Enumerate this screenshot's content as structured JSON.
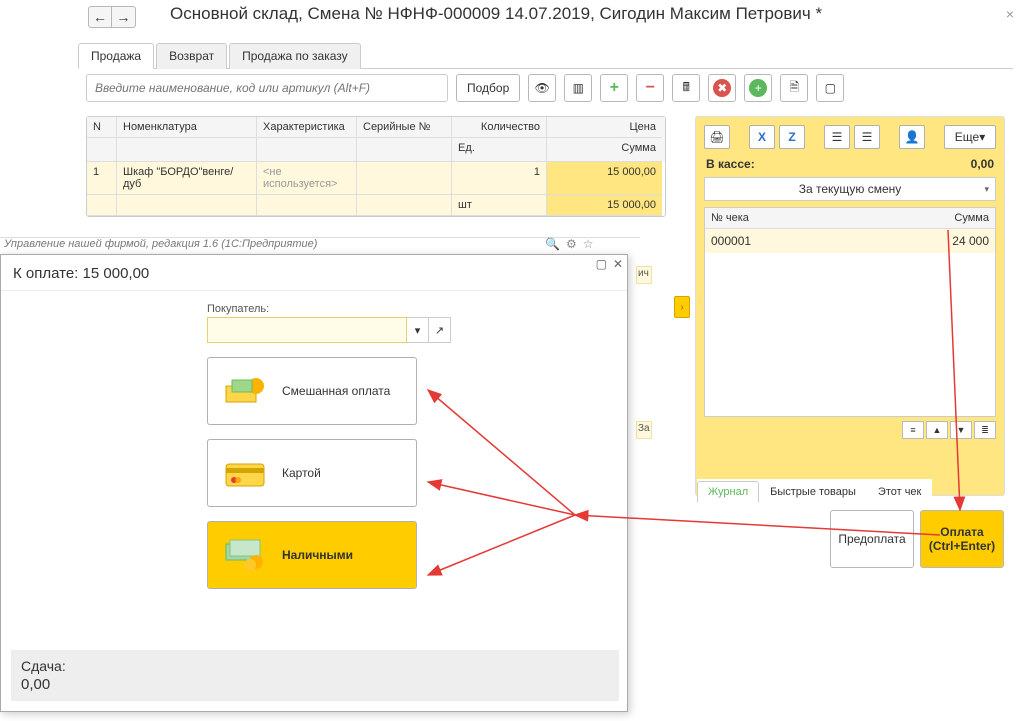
{
  "header": {
    "back": "←",
    "fwd": "→",
    "title": "Основной склад, Смена № НФНФ-000009  14.07.2019, Сигодин Максим Петрович *"
  },
  "tabs": {
    "t1": "Продажа",
    "t2": "Возврат",
    "t3": "Продажа по заказу"
  },
  "search": {
    "ph": "Введите наименование, код или артикул (Alt+F)"
  },
  "toolbar": {
    "pick": "Подбор",
    "eye": "👁",
    "bar": "⎙",
    "plus": "+",
    "minus": "−",
    "calc": "⌸",
    "del": "✖",
    "add": "+",
    "doc": "⎘",
    "ex": "▢"
  },
  "grid": {
    "h": {
      "n": "N",
      "nm": "Номенклатура",
      "ch": "Характеристика",
      "sn": "Серийные №",
      "qt": "Количество",
      "pr": "Цена",
      "ed": "Ед.",
      "sum": "Сумма"
    },
    "r": {
      "n": "1",
      "nm": "Шкаф \"БОРДО\"венге/дуб",
      "ch": "<не используется>",
      "qt": "1",
      "pr": "15 000,00",
      "ed": "шт",
      "sum": "15 000,00"
    }
  },
  "panel": {
    "cash_lbl": "В кассе:",
    "cash_val": "0,00",
    "shift": "За текущую смену",
    "h_no": "№ чека",
    "h_sum": "Сумма",
    "r_no": "000001",
    "r_sum": "24 000",
    "more": "Еще",
    "tabs": {
      "t1": "Журнал",
      "t2": "Быстрые товары",
      "t3": "Этот чек"
    }
  },
  "buttons": {
    "prepay": "Предоплата",
    "pay": "Оплата (Ctrl+Enter)"
  },
  "modal": {
    "bar": "Управление нашей фирмой, редакция 1.6 (1С:Предприятие)",
    "total_lbl": "К оплате:",
    "total": "15 000,00",
    "buyer": "Покупатель:",
    "m1": "Смешанная оплата",
    "m2": "Картой",
    "m3": "Наличными",
    "change_lbl": "Сдача:",
    "change": "0,00"
  },
  "stray": {
    "s1": "ич",
    "s2": "За"
  }
}
